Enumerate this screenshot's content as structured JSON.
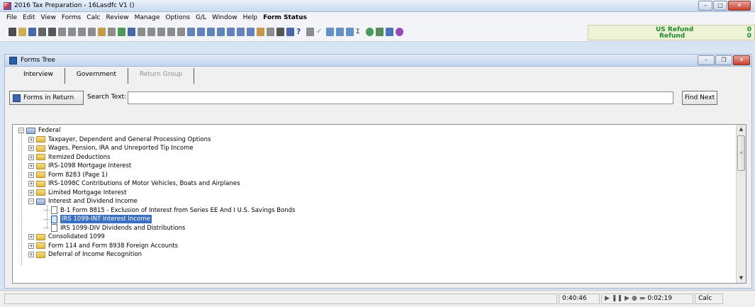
{
  "window": {
    "title": "2016 Tax Preparation - 16Lasdfc V1 ()"
  },
  "menu": [
    "File",
    "Edit",
    "View",
    "Forms",
    "Calc",
    "Review",
    "Manage",
    "Options",
    "G/L",
    "Window",
    "Help",
    "Form Status"
  ],
  "refund": {
    "line1_label": "US Refund",
    "line1_value": "0",
    "line2_label": "Refund",
    "line2_value": "0"
  },
  "forms_tree": {
    "title": "Forms Tree",
    "tabs": [
      {
        "label": "Interview",
        "enabled": true
      },
      {
        "label": "Government",
        "enabled": true
      },
      {
        "label": "Return Group",
        "enabled": false
      }
    ],
    "forms_in_return_label": "Forms in Return",
    "search_label": "Search Text:",
    "search_value": "",
    "find_next_label": "Find Next",
    "items": [
      {
        "label": "Federal",
        "level": 0,
        "type": "folder-open",
        "expanded": true
      },
      {
        "label": "Taxpayer, Dependent and General Processing Options",
        "level": 1,
        "type": "folder"
      },
      {
        "label": "Wages, Pension, IRA and Unreported Tip Income",
        "level": 1,
        "type": "folder"
      },
      {
        "label": "Itemized Deductions",
        "level": 1,
        "type": "folder"
      },
      {
        "label": "IRS-1098 Mortgage Interest",
        "level": 1,
        "type": "folder"
      },
      {
        "label": "Form 8283 (Page 1)",
        "level": 1,
        "type": "folder"
      },
      {
        "label": "IRS-1098C Contributions of Motor Vehicles, Boats and Airplanes",
        "level": 1,
        "type": "folder"
      },
      {
        "label": "Limited Mortgage Interest",
        "level": 1,
        "type": "folder"
      },
      {
        "label": "Interest and Dividend Income",
        "level": 1,
        "type": "folder-open",
        "expanded": true
      },
      {
        "label": "B-1  Form 8815 - Exclusion of Interest from Series EE And I U.S. Savings Bonds",
        "level": 2,
        "type": "doc"
      },
      {
        "label": "IRS 1099-INT  Interest Income",
        "level": 2,
        "type": "doc",
        "selected": true
      },
      {
        "label": "IRS 1099-DIV  Dividends and Distributions",
        "level": 2,
        "type": "doc"
      },
      {
        "label": "Consolidated 1099",
        "level": 1,
        "type": "folder"
      },
      {
        "label": "Form 114 and Form 8938 Foreign Accounts",
        "level": 1,
        "type": "folder"
      },
      {
        "label": "Deferral of Income Recognition",
        "level": 1,
        "type": "folder"
      }
    ]
  },
  "status": {
    "elapsed": "0:40:46",
    "timer": "0:02:19",
    "mode": "Calc"
  },
  "toolbar_icons": [
    "new-icon",
    "open-icon",
    "save-icon",
    "print-preview-icon",
    "print-icon",
    "form-icon",
    "form2-icon",
    "view-icon",
    "note-icon",
    "attach-icon",
    "grid-icon",
    "add-icon",
    "minus-icon",
    "home-icon",
    "link-icon",
    "link2-icon",
    "report-icon",
    "pin-icon",
    "list-icon",
    "list2-icon",
    "list3-icon",
    "list4-icon",
    "list5-icon",
    "list6-icon",
    "list7-icon",
    "tree-icon",
    "merge-icon",
    "calc-icon",
    "diamond-icon",
    "help-icon",
    "back-icon",
    "check-icon",
    "block1-icon",
    "block2-icon",
    "block3-icon",
    "sigma-icon",
    "globe-icon",
    "people-icon",
    "book-icon",
    "gear-icon"
  ]
}
